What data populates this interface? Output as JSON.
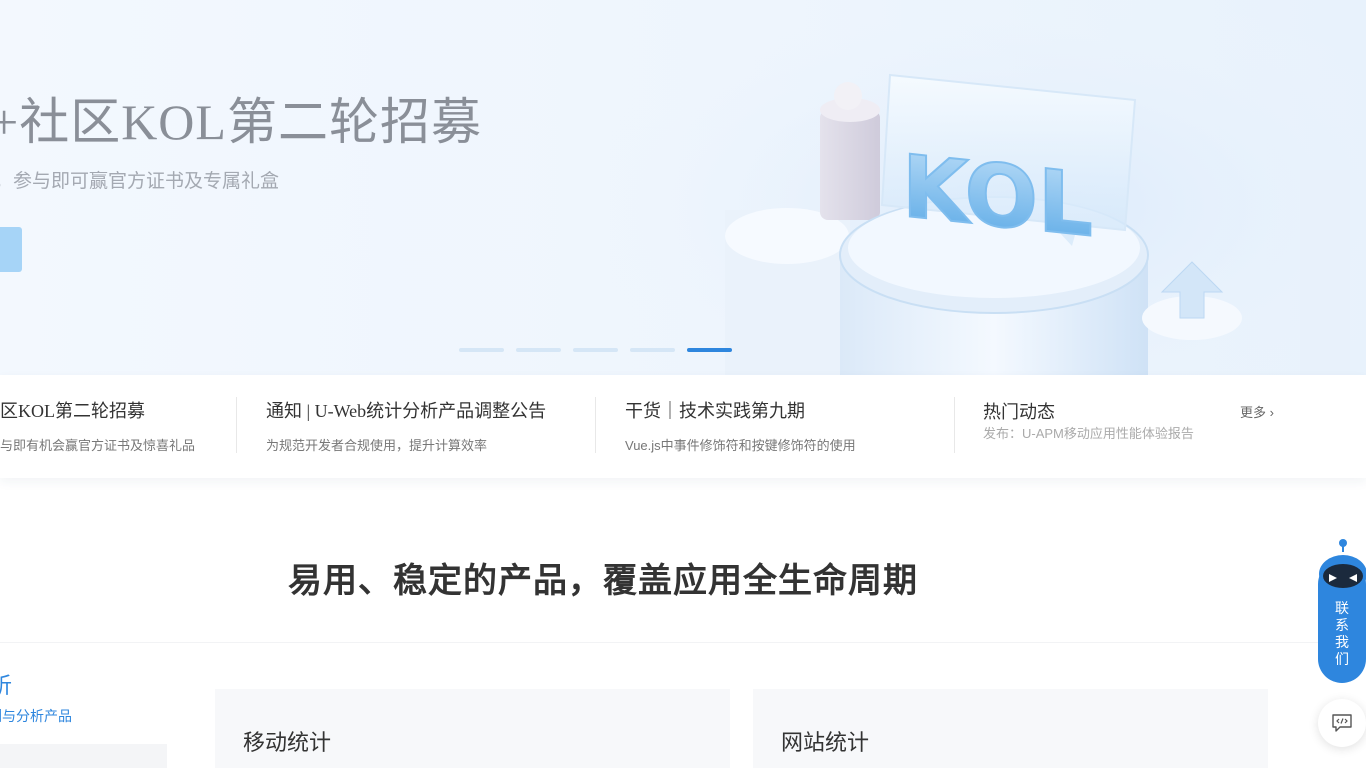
{
  "hero": {
    "title": "+社区KOL第二轮招募",
    "subtitle": "，参与即可赢官方证书及专属礼盒",
    "art_text": "KOL",
    "slide_count": 5,
    "active_slide": 5
  },
  "notices": [
    {
      "title": "区KOL第二轮招募",
      "desc": "与即有机会赢官方证书及惊喜礼品"
    },
    {
      "title": "通知 | U-Web统计分析产品调整公告",
      "desc": "为规范开发者合规使用，提升计算效率"
    },
    {
      "title": "干货｜技术实践第九期",
      "desc": "Vue.js中事件修饰符和按键修饰符的使用"
    }
  ],
  "hot": {
    "title": "热门动态",
    "more": "更多",
    "ticker": "发布：U-APM移动应用性能体验报告"
  },
  "section": {
    "title": "易用、稳定的产品，覆盖应用全生命周期"
  },
  "left_tab": {
    "title": "析",
    "desc": "测与分析产品"
  },
  "cards": [
    {
      "title": "移动统计"
    },
    {
      "title": "网站统计"
    }
  ],
  "widgets": {
    "robot_label": "联系我们"
  },
  "colors": {
    "accent": "#2e86de",
    "hero_button": "#a6d4f7"
  }
}
